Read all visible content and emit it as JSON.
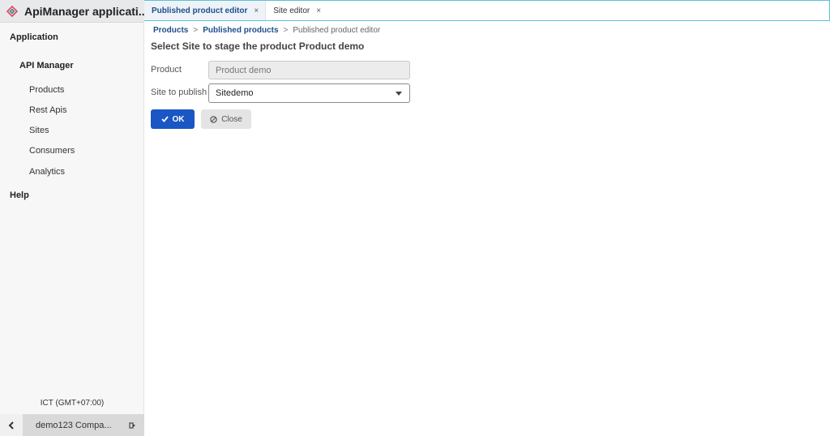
{
  "app": {
    "title": "ApiManager applicati..."
  },
  "sidebar": {
    "application_label": "Application",
    "api_manager_label": "API Manager",
    "items": [
      {
        "label": "Products"
      },
      {
        "label": "Rest Apis"
      },
      {
        "label": "Sites"
      },
      {
        "label": "Consumers"
      },
      {
        "label": "Analytics"
      }
    ],
    "help_label": "Help",
    "timezone": "ICT (GMT+07:00)",
    "user": "demo123 Compa..."
  },
  "tabs": [
    {
      "label": "Published product editor",
      "close": "×",
      "active": true
    },
    {
      "label": "Site editor",
      "close": "×",
      "active": false
    }
  ],
  "breadcrumb": {
    "items": [
      "Products",
      "Published products"
    ],
    "separator": ">",
    "current": "Published product editor"
  },
  "form": {
    "title": "Select Site to stage the product Product demo",
    "product_label": "Product",
    "product_value": "Product demo",
    "site_label": "Site to publish",
    "site_value": "Sitedemo"
  },
  "buttons": {
    "ok_label": "OK",
    "close_label": "Close"
  },
  "colors": {
    "primary": "#1a56c4",
    "tab_border": "#5cc1d6",
    "link": "#1f4e8c"
  }
}
